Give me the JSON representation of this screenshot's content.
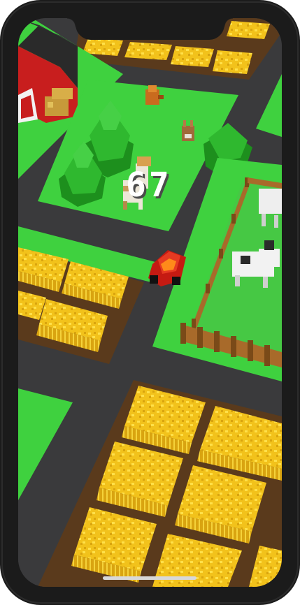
{
  "game": {
    "score": "67"
  },
  "colors": {
    "grass": "#3fd13f",
    "road": "#3a3a3c",
    "hay": "#f2c21b",
    "soil": "#5a3a1c",
    "barn": "#c81e1e",
    "car": "#c51a12",
    "fence": "#a86a2a",
    "tree": "#2fb82f"
  }
}
